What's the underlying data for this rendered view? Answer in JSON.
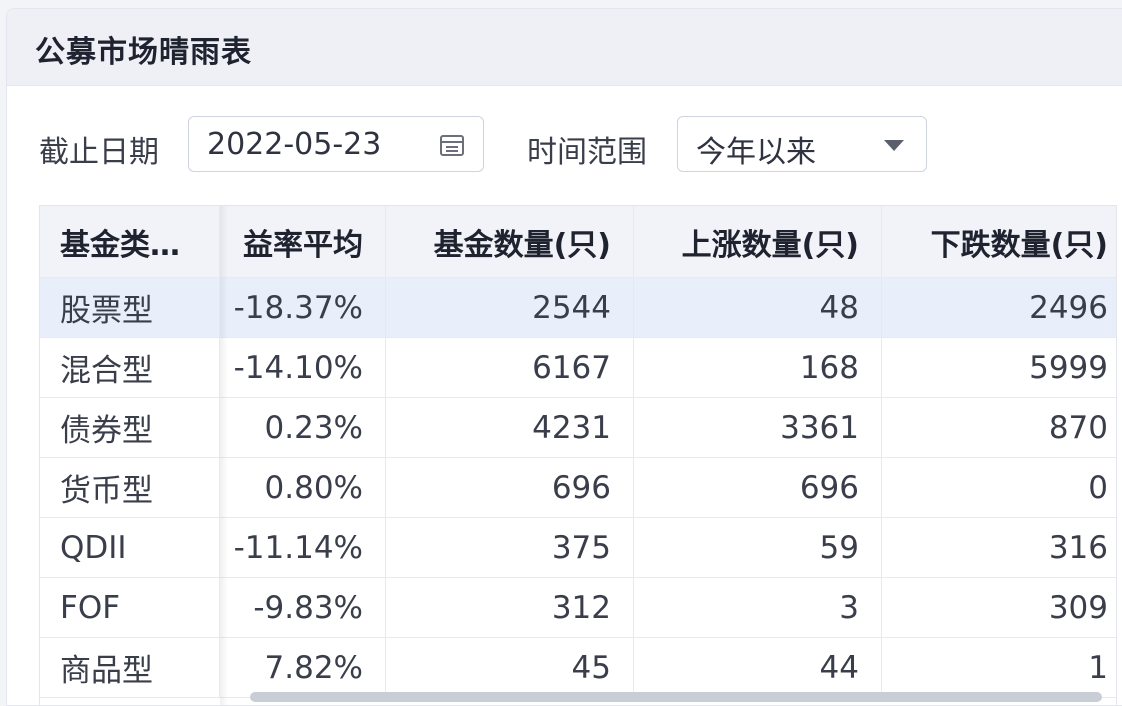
{
  "panel": {
    "title": "公募市场晴雨表"
  },
  "filters": {
    "date_label": "截止日期",
    "date_value": "2022-05-23",
    "range_label": "时间范围",
    "range_value": "今年以来"
  },
  "table": {
    "headers": [
      "基金类…",
      "益率平均",
      "基金数量(只)",
      "上涨数量(只)",
      "下跌数量(只)"
    ],
    "rows": [
      [
        "股票型",
        "-18.37%",
        "2544",
        "48",
        "2496"
      ],
      [
        "混合型",
        "-14.10%",
        "6167",
        "168",
        "5999"
      ],
      [
        "债券型",
        "0.23%",
        "4231",
        "3361",
        "870"
      ],
      [
        "货币型",
        "0.80%",
        "696",
        "696",
        "0"
      ],
      [
        "QDII",
        "-11.14%",
        "375",
        "59",
        "316"
      ],
      [
        "FOF",
        "-9.83%",
        "312",
        "3",
        "309"
      ],
      [
        "商品型",
        "7.82%",
        "45",
        "44",
        "1"
      ]
    ]
  },
  "icons": {
    "date_picker": "calendar-icon",
    "range_dropdown": "caret-down-icon"
  },
  "colors": {
    "selected_row": "#e8effb",
    "header_bg": "#f1f3f8"
  }
}
